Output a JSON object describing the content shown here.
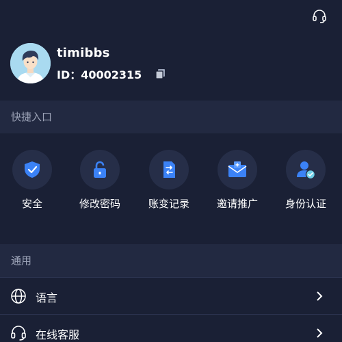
{
  "profile": {
    "username": "timibbs",
    "id_text": "ID：40002315"
  },
  "quick_entry": {
    "title": "快捷入口",
    "items": [
      {
        "label": "安全",
        "icon": "shield-check-icon"
      },
      {
        "label": "修改密码",
        "icon": "unlock-icon"
      },
      {
        "label": "账变记录",
        "icon": "transfer-document-icon"
      },
      {
        "label": "邀请推广",
        "icon": "invite-envelope-icon"
      },
      {
        "label": "身份认证",
        "icon": "user-verified-icon"
      }
    ]
  },
  "general": {
    "title": "通用",
    "items": [
      {
        "label": "语言",
        "icon": "globe-icon"
      },
      {
        "label": "在线客服",
        "icon": "headset-icon"
      }
    ]
  },
  "colors": {
    "background": "#1a2035",
    "section": "#222941",
    "icon_blue": "#3b82f6",
    "circle": "#262e48"
  }
}
